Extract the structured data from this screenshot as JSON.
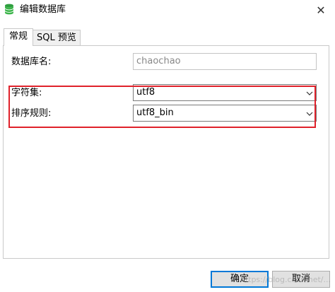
{
  "window": {
    "title": "编辑数据库",
    "close_glyph": "✕"
  },
  "tabs": [
    {
      "label": "常规",
      "active": true
    },
    {
      "label": "SQL 预览",
      "active": false
    }
  ],
  "form": {
    "db_name": {
      "label": "数据库名:",
      "value": "chaochao"
    },
    "charset": {
      "label": "字符集:",
      "value": "utf8"
    },
    "collation": {
      "label": "排序规则:",
      "value": "utf8_bin"
    }
  },
  "buttons": {
    "ok": "确定",
    "cancel": "取消"
  },
  "watermark": "https://blog.csdn.net/...",
  "colors": {
    "highlight": "#e0212b",
    "db_icon": "#2e9e3f",
    "focus": "#0078d7"
  },
  "icons": {
    "app": "database-icon",
    "close": "close-icon",
    "dropdown": "chevron-down-icon"
  }
}
